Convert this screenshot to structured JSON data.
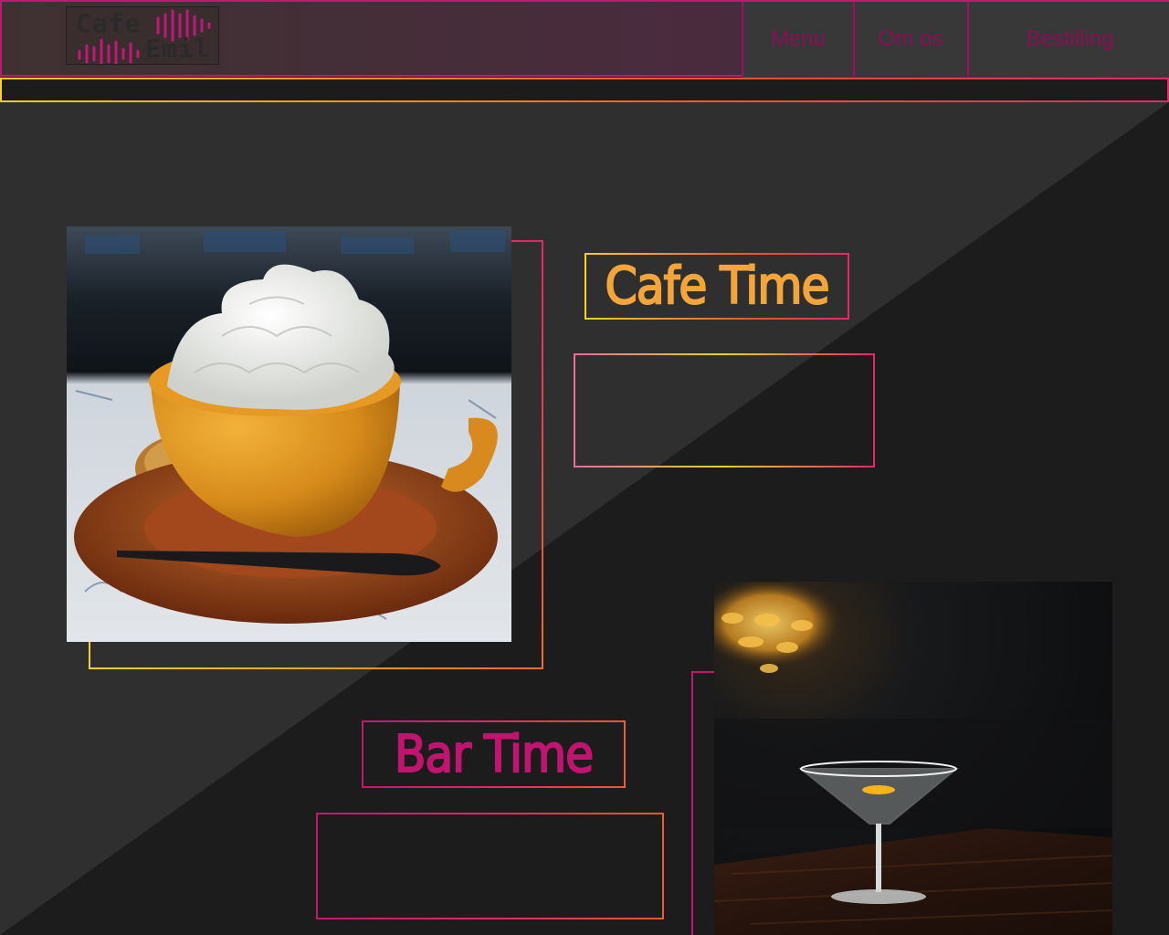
{
  "brand": {
    "line1": "Cafe",
    "line2": "Emil"
  },
  "nav": {
    "items": [
      {
        "label": "Menu"
      },
      {
        "label": "Om os"
      },
      {
        "label": "Bestilling"
      }
    ]
  },
  "sections": {
    "cafe": {
      "title": "Cafe Time",
      "description": ""
    },
    "bar": {
      "title": "Bar Time",
      "description": ""
    }
  },
  "colors": {
    "accent_pink": "#c2186e",
    "accent_yellow": "#ffd21f",
    "accent_orange": "#f25a2a",
    "background_dark": "#1c1c1c",
    "background_light": "#2f2f2f"
  }
}
